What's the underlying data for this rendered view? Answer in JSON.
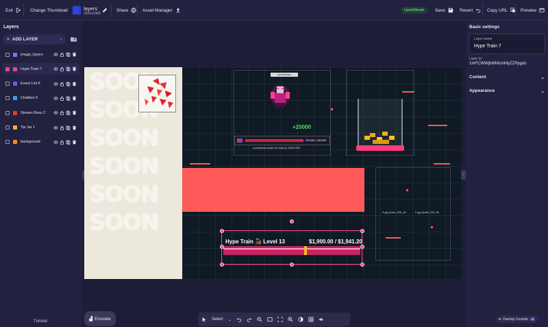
{
  "topbar": {
    "exit_label": "Exit",
    "change_thumbnail_label": "Change Thumbnail",
    "thumbnail_color": "#2b46e8",
    "overlay_title": "layers",
    "overlay_resolution": "1920x1080",
    "share_label": "Share",
    "asset_manager_label": "Asset Manager",
    "account_badge": "LyonsStream",
    "save_label": "Save",
    "revert_label": "Revert",
    "copy_url_label": "Copy URL",
    "preview_label": "Preview"
  },
  "layers_panel": {
    "title": "Layers",
    "add_layer_label": "ADD LAYER",
    "items": [
      {
        "label": "image_layers",
        "icon": "image-icon",
        "color": "#7a7af0",
        "checked": false,
        "selected": false
      },
      {
        "label": "Hype Train 7",
        "icon": "train-icon",
        "color": "#e94482",
        "checked": true,
        "selected": true
      },
      {
        "label": "Event List 6",
        "icon": "list-icon",
        "color": "#4a6cf0",
        "checked": false,
        "selected": false
      },
      {
        "label": "Chatbox 5",
        "icon": "chat-icon",
        "color": "#3aa0e8",
        "checked": false,
        "selected": false
      },
      {
        "label": "Stream Boss 2",
        "icon": "boss-icon",
        "color": "#e83a3a",
        "checked": false,
        "selected": false
      },
      {
        "label": "Tip Jar 1",
        "icon": "jar-icon",
        "color": "#f0b03a",
        "checked": false,
        "selected": false
      },
      {
        "label": "background",
        "icon": "background-icon",
        "color": "#f08a2a",
        "checked": false,
        "selected": false
      }
    ],
    "tutorial_label": "Tutorial"
  },
  "right_panel": {
    "basic_settings_title": "Basic settings",
    "layer_name_label": "Layer name",
    "layer_name_value": "Hype Train 7",
    "layer_id_label": "Layer id",
    "layer_id_value": "1mFCWWjbWMcmMyZZPpgdo",
    "content_label": "Content",
    "appearance_label": "Appearance"
  },
  "canvas": {
    "soon_words": [
      "SOON",
      "SOON",
      "SOON",
      "SOON",
      "SOON",
      "SOON"
    ],
    "boss_name": "LyonsStream",
    "boss_hp": "251000 / 251000",
    "boss_note": "LyonsStream fested the boss for 20000 DMT",
    "boss_score": "+20000",
    "burst_labels": [
      "ga_burst_155_18",
      "ga_burst_142_18"
    ],
    "hype_train_title": "Hype Train 🚂 Level 13",
    "hype_train_amount": "$1,900.00 / $1,941.20",
    "colors": {
      "accent": "#ff5a5a",
      "handle": "#ff4f8b"
    }
  },
  "bottom": {
    "emulate_label": "Emulate",
    "select_label": "Select",
    "overlay_console_label": "Overlay Console",
    "console_count": "N"
  }
}
